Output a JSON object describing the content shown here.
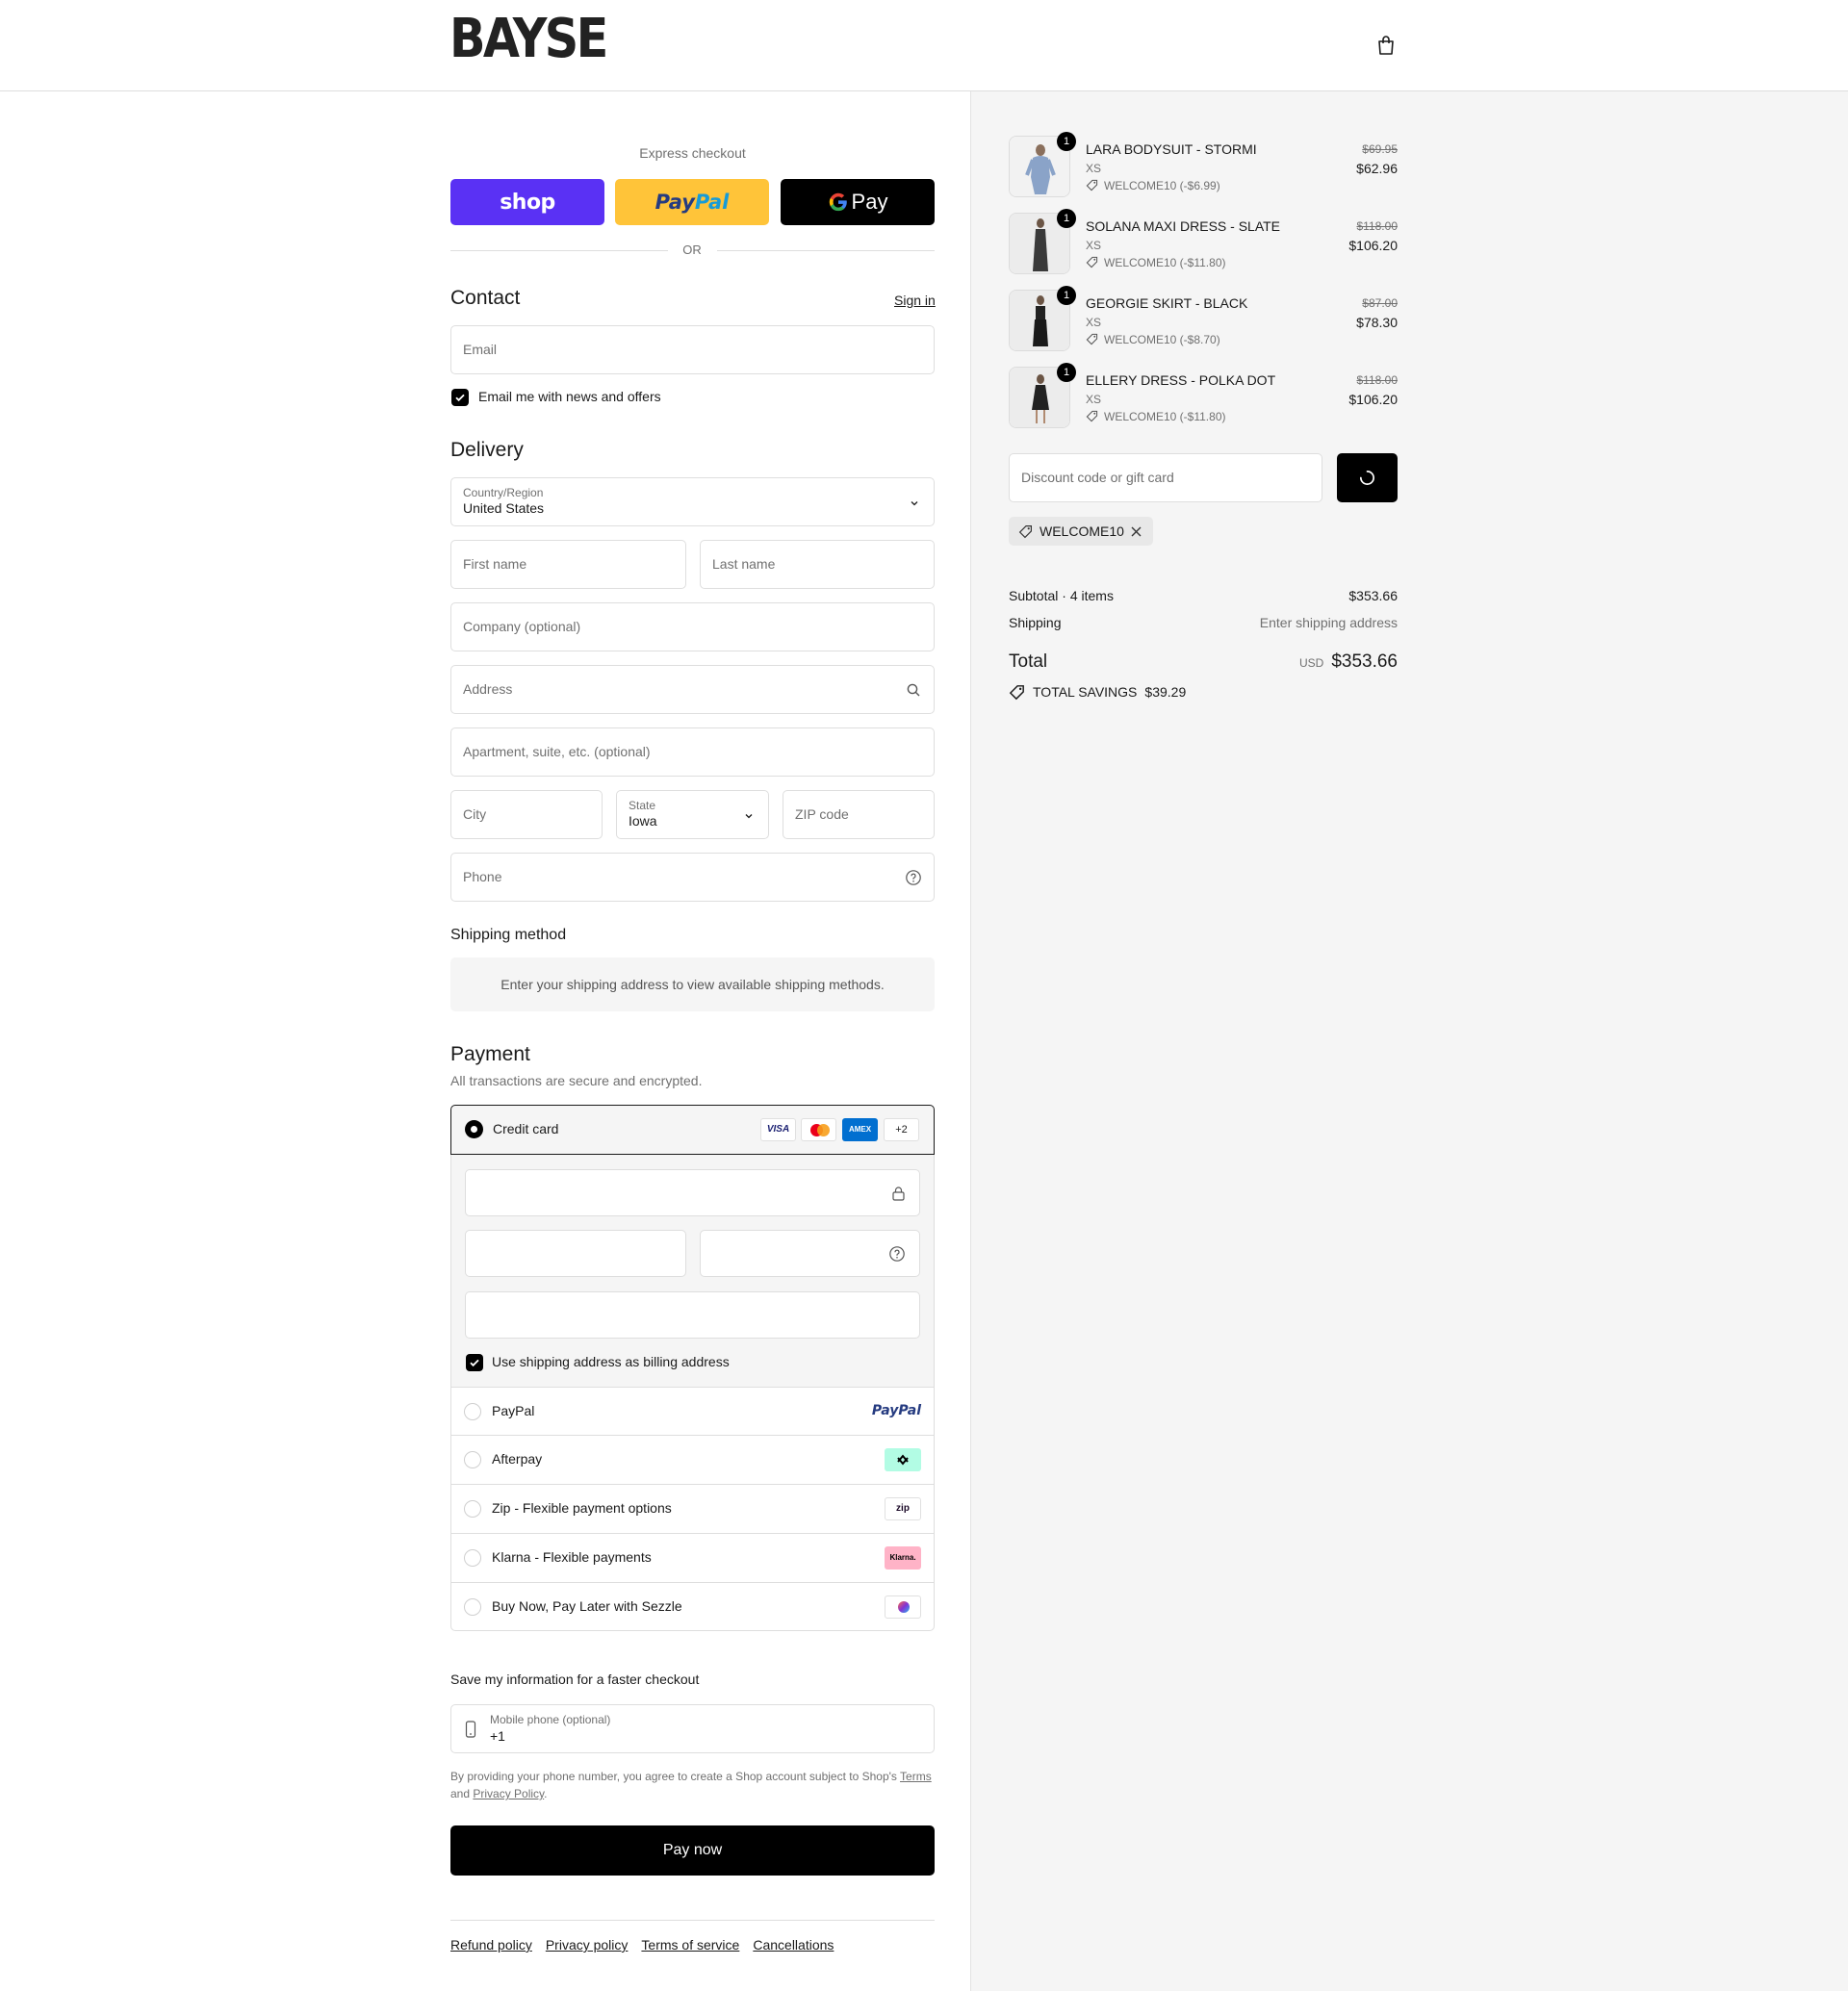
{
  "brand": "BAYSE",
  "express": {
    "title": "Express checkout",
    "shop_label": "shop",
    "paypal_label_a": "Pay",
    "paypal_label_b": "Pal",
    "gpay_label": "Pay",
    "or_label": "OR"
  },
  "contact": {
    "title": "Contact",
    "signin": "Sign in",
    "email_placeholder": "Email",
    "news_label": "Email me with news and offers"
  },
  "delivery": {
    "title": "Delivery",
    "country_label": "Country/Region",
    "country_value": "United States",
    "first_name": "First name",
    "last_name": "Last name",
    "company": "Company (optional)",
    "address": "Address",
    "apartment": "Apartment, suite, etc. (optional)",
    "city": "City",
    "state_label": "State",
    "state_value": "Iowa",
    "zip": "ZIP code",
    "phone": "Phone"
  },
  "shipping": {
    "title": "Shipping method",
    "notice": "Enter your shipping address to view available shipping methods."
  },
  "payment": {
    "title": "Payment",
    "subtitle": "All transactions are secure and encrypted.",
    "credit_card": "Credit card",
    "visa": "VISA",
    "amex": "AMEX",
    "more_cards": "+2",
    "billing_same": "Use shipping address as billing address",
    "methods": [
      {
        "label": "PayPal",
        "logo": "PayPal"
      },
      {
        "label": "Afterpay",
        "logo": "afterpay-icon"
      },
      {
        "label": "Zip - Flexible payment options",
        "logo": "zip"
      },
      {
        "label": "Klarna - Flexible payments",
        "logo": "Klarna."
      },
      {
        "label": "Buy Now, Pay Later with Sezzle",
        "logo": "sezzle-icon"
      }
    ]
  },
  "save_info": {
    "title": "Save my information for a faster checkout",
    "mobile_label": "Mobile phone (optional)",
    "mobile_value": "+1",
    "legal_prefix": "By providing your phone number, you agree to create a Shop account subject to Shop's",
    "terms": "Terms",
    "and": "and",
    "privacy": "Privacy Policy",
    "period": "."
  },
  "pay_now": "Pay now",
  "footer_links": [
    "Refund policy",
    "Privacy policy",
    "Terms of service",
    "Cancellations"
  ],
  "order": {
    "items": [
      {
        "name": "LARA BODYSUIT - STORMI",
        "variant": "XS",
        "discount": "WELCOME10 (-$6.99)",
        "old_price": "$69.95",
        "price": "$62.96",
        "qty": "1"
      },
      {
        "name": "SOLANA MAXI DRESS - SLATE",
        "variant": "XS",
        "discount": "WELCOME10 (-$11.80)",
        "old_price": "$118.00",
        "price": "$106.20",
        "qty": "1"
      },
      {
        "name": "GEORGIE SKIRT - BLACK",
        "variant": "XS",
        "discount": "WELCOME10 (-$8.70)",
        "old_price": "$87.00",
        "price": "$78.30",
        "qty": "1"
      },
      {
        "name": "ELLERY DRESS - POLKA DOT",
        "variant": "XS",
        "discount": "WELCOME10 (-$11.80)",
        "old_price": "$118.00",
        "price": "$106.20",
        "qty": "1"
      }
    ],
    "discount_placeholder": "Discount code or gift card",
    "applied_code": "WELCOME10",
    "subtotal_label": "Subtotal · 4 items",
    "subtotal_value": "$353.66",
    "shipping_label": "Shipping",
    "shipping_value": "Enter shipping address",
    "total_label": "Total",
    "currency": "USD",
    "total_value": "$353.66",
    "savings_label": "TOTAL SAVINGS",
    "savings_value": "$39.29"
  },
  "colors": {
    "shop_pay": "#5a31f4",
    "paypal": "#ffc439",
    "black": "#000000",
    "panel_bg": "#f5f5f5"
  }
}
